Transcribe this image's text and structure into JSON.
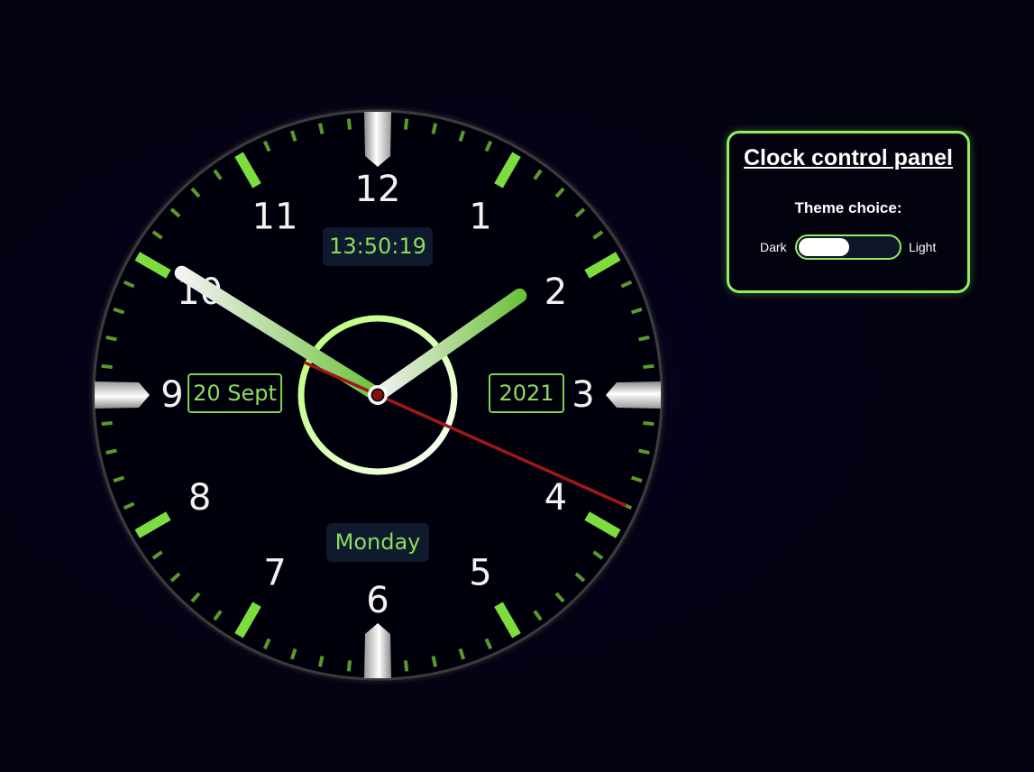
{
  "clock": {
    "numerals": [
      "12",
      "1",
      "2",
      "3",
      "4",
      "5",
      "6",
      "7",
      "8",
      "9",
      "10",
      "11"
    ],
    "time": {
      "hours": 13,
      "minutes": 50,
      "seconds": 19
    },
    "digital_time": "13:50:19",
    "date_day_month": "20 Sept",
    "year": "2021",
    "weekday": "Monday"
  },
  "panel": {
    "title": "Clock control panel",
    "theme_label": "Theme choice:",
    "option_dark": "Dark",
    "option_light": "Light",
    "theme_toggle_value": "Dark"
  },
  "colors": {
    "background": "#040217",
    "accent_green": "#8ef25c",
    "text_green": "#8cdc5c",
    "second_hand": "#a01818",
    "numeral": "#f2f2f2"
  }
}
